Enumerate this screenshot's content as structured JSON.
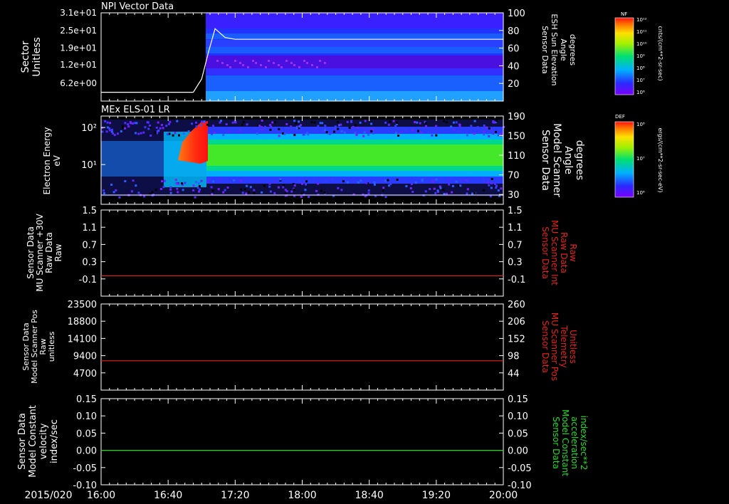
{
  "time_axis": {
    "date_label": "2015/020",
    "ticks": [
      "16:00",
      "16:40",
      "17:20",
      "18:00",
      "18:40",
      "19:20",
      "20:00"
    ],
    "range_hours": [
      16.0,
      20.0
    ]
  },
  "colorbars": [
    {
      "tag": "NF",
      "unit": "cnts/(cm**2-sr-sec)",
      "tick_labels": [
        "10¹²",
        "10¹¹",
        "10¹⁰",
        "10⁹",
        "10⁸",
        "10⁷",
        "10⁶"
      ]
    },
    {
      "tag": "DEF",
      "unit": "ergs/(cm**2-sr-sec-eV)",
      "tick_labels": [
        "10⁸",
        "10⁷",
        "10⁶"
      ]
    }
  ],
  "colors": {
    "trace_red": "#e8201c",
    "trace_green": "#22dd22",
    "trace_white": "#ffffff"
  },
  "chart_data": [
    {
      "type": "heatmap",
      "title": "NPI Vector Data",
      "ylabel": [
        "Sector",
        "Unitless"
      ],
      "yticks_left": [
        "3.1e+01",
        "2.5e+01",
        "1.9e+01",
        "1.2e+01",
        "6.2e+00"
      ],
      "ylabel_right": [
        "Sensor Data",
        "ESH Sun Elevation",
        "Angle",
        "degrees"
      ],
      "yticks_right": [
        "100",
        "80",
        "60",
        "40",
        "20"
      ],
      "ylim_right": [
        0,
        100
      ],
      "line_series": {
        "name": "ESH Sun Elevation Angle",
        "x": [
          "16:00",
          "16:30",
          "16:55",
          "17:00",
          "17:04",
          "17:08",
          "17:14",
          "17:20",
          "18:00",
          "20:00"
        ],
        "y": [
          10,
          10,
          10,
          25,
          55,
          82,
          72,
          70,
          70,
          70
        ]
      },
      "data_start": "17:04"
    },
    {
      "type": "heatmap",
      "title": "MEx ELS-01 LR",
      "ylabel": [
        "Electron Energy",
        "eV"
      ],
      "yticks_left": [
        "10²",
        "10¹"
      ],
      "yscale": "log",
      "ylabel_right": [
        "Sensor Data",
        "Model Scanner",
        "Angle",
        "degrees"
      ],
      "yticks_right": [
        "190",
        "150",
        "110",
        "70",
        "30"
      ],
      "ylim_right": [
        10,
        190
      ],
      "line_series": {
        "name": "Model Scanner Angle",
        "x": [
          "16:00",
          "20:00"
        ],
        "y": [
          10,
          10
        ]
      }
    },
    {
      "type": "line",
      "ylabel": [
        "Sensor Data",
        "MU Scanner +30V",
        "Raw Data",
        "Raw"
      ],
      "yticks_left": [
        "1.5",
        "1.1",
        "0.7",
        "0.3",
        "-0.1"
      ],
      "ylim": [
        -0.5,
        1.5
      ],
      "ylabel_right": [
        "Sensor Data",
        "MU Scanner Int",
        "Raw Data",
        "Raw"
      ],
      "yticks_right": [
        "1.5",
        "1.1",
        "0.7",
        "0.3",
        "-0.1"
      ],
      "series": [
        {
          "x": [
            "16:00",
            "20:00"
          ],
          "y": [
            -0.03,
            -0.03
          ]
        }
      ]
    },
    {
      "type": "line",
      "ylabel": [
        "Sensor Data",
        "Model Scanner Pos",
        "Raw",
        "unitless"
      ],
      "yticks_left": [
        "23500",
        "18800",
        "14100",
        "9400",
        "4700"
      ],
      "ylim": [
        0,
        23500
      ],
      "ylabel_right": [
        "Sensor Data",
        "MU Scanner Pos",
        "Telemetry",
        "Unitless"
      ],
      "yticks_right": [
        "260",
        "206",
        "152",
        "98",
        "44"
      ],
      "series": [
        {
          "x": [
            "16:00",
            "20:00"
          ],
          "y": [
            8000,
            8000
          ]
        }
      ]
    },
    {
      "type": "line",
      "ylabel": [
        "Sensor Data",
        "Model Constant",
        "velocity",
        "index/sec"
      ],
      "yticks_left": [
        "0.15",
        "0.10",
        "0.05",
        "0.00",
        "-0.05",
        "-0.10"
      ],
      "ylim": [
        -0.1,
        0.15
      ],
      "ylabel_right": [
        "Sensor Data",
        "Model Constant",
        "acceleration",
        "index/sec**2"
      ],
      "yticks_right": [
        "0.15",
        "0.10",
        "0.05",
        "0.00",
        "-0.05",
        "-0.10"
      ],
      "series": [
        {
          "x": [
            "16:00",
            "20:00"
          ],
          "y": [
            0.0,
            0.0
          ]
        }
      ]
    }
  ]
}
